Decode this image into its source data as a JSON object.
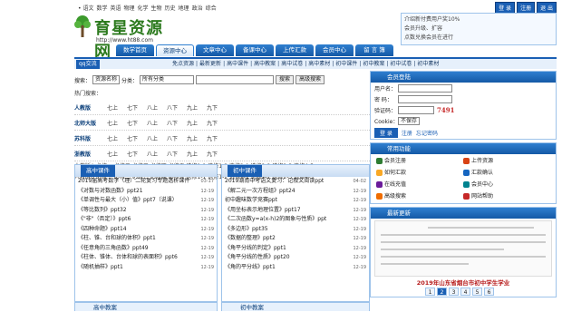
{
  "header": {
    "subjects": [
      "• 语文",
      "数学",
      "英语",
      "物理",
      "化学",
      "生物",
      "历史",
      "地理",
      "政治",
      "综合"
    ],
    "login_btn": "登 录",
    "register_btn": "注册",
    "logout_btn": "退 出",
    "logo_name": "育星资源网",
    "logo_url": "http://www.ht88.com",
    "notices": [
      "介绍新付费用户奖10%",
      "会员升级、扩容",
      "点数兑换会员在进行"
    ]
  },
  "nav": [
    "数学首页",
    "资源中心",
    "文章中心",
    "备课中心",
    "上传汇款",
    "会员中心",
    "留 言 簿"
  ],
  "nav_active": 1,
  "subnav": {
    "tag": "qq交流",
    "links": [
      "免点资源",
      "最新更新",
      "高中课件",
      "高中教案",
      "高中试卷",
      "高中素材",
      "初中课件",
      "初中教案",
      "初中试卷",
      "初中素材"
    ]
  },
  "search": {
    "label": "搜索：",
    "type_select": "资源名称",
    "cat_select": "所有分类",
    "search_btn": "搜索",
    "adv_btn": "高级搜索"
  },
  "hot_label": "热门搜索：",
  "editions": [
    {
      "name": "人教版",
      "grades": [
        "七上",
        "七下",
        "八上",
        "八下",
        "九上",
        "九下"
      ]
    },
    {
      "name": "北师大版",
      "grades": [
        "七上",
        "七下",
        "八上",
        "八下",
        "九上",
        "九下"
      ]
    },
    {
      "name": "苏科版",
      "grades": [
        "七上",
        "七下",
        "八上",
        "八下",
        "九上",
        "九下"
      ]
    },
    {
      "name": "浙教版",
      "grades": [
        "七上",
        "七下",
        "八上",
        "八下",
        "九上",
        "九下"
      ]
    }
  ],
  "high_a": "人教版A  必修一  必修二  必修三  必修四  必修五  选修1-1  选修1-2  选修2-1  选修2-2  选修2-3  选修4-5",
  "high_b": "人教版B  必修一  必修二  必修三  必修四  必修五  选修1-1  选修1-2  选修2-1  选修2-2  选修2-3  选修4-5",
  "panel_high": {
    "title": "高中课件",
    "items": [
      {
        "t": "2019届高考数学（理）二轮复习专题透析课件",
        "d": "03-17"
      },
      {
        "t": "《对数与对数函数》ppt21",
        "d": "12-19"
      },
      {
        "t": "《单调性与最大（小）值》ppt7（说课）",
        "d": "12-19"
      },
      {
        "t": "《等比数列》ppt32",
        "d": "12-19"
      },
      {
        "t": "《\"非\"（否定）》ppt6",
        "d": "12-19"
      },
      {
        "t": "《四种命题》ppt14",
        "d": "12-19"
      },
      {
        "t": "《柱、锥、台和球的体积》ppt1",
        "d": "12-19"
      },
      {
        "t": "《任意角的三角函数》ppt49",
        "d": "12-19"
      },
      {
        "t": "《柱体、锥体、台体和球的表面积》ppt6",
        "d": "12-19"
      },
      {
        "t": "《随机抽样》ppt1",
        "d": "12-19"
      }
    ]
  },
  "panel_mid": {
    "title": "初中课件",
    "items": [
      {
        "t": "2019湖南中考语文复习：记叙文阅读ppt",
        "d": "04-02"
      },
      {
        "t": "《解二元一次方程组》ppt24",
        "d": "12-19"
      },
      {
        "t": "初中趣味数学竞赛ppt",
        "d": "12-19"
      },
      {
        "t": "《用坐标表示地理位置》ppt17",
        "d": "12-19"
      },
      {
        "t": "《二次函数y=a(x-h)2的图象与性质》ppt",
        "d": "12-19"
      },
      {
        "t": "《多边形》ppt35",
        "d": "12-19"
      },
      {
        "t": "《数据的整理》ppt2",
        "d": "12-19"
      },
      {
        "t": "《角平分线的判定》ppt1",
        "d": "12-19"
      },
      {
        "t": "《角平分线的性质》ppt20",
        "d": "12-19"
      },
      {
        "t": "《角的平分线》ppt1",
        "d": "12-19"
      }
    ]
  },
  "bottom_tabs": [
    "高中教案",
    "初中教案"
  ],
  "side": {
    "login_title": "会员登陆",
    "user_label": "用户名：",
    "pass_label": "密  码：",
    "code_label": "验证码：",
    "code_value": "7491",
    "cookie_label": "Cookie：",
    "cookie_select": "不保存",
    "login_btn": "登 录",
    "register_link": "注册",
    "forgot_link": "忘记密码",
    "funcs_title": "常用功能",
    "funcs": [
      {
        "label": "会员注册",
        "icon": "user-add-icon",
        "color": "#2e7d32"
      },
      {
        "label": "上传资源",
        "icon": "upload-icon",
        "color": "#d84315"
      },
      {
        "label": "如何汇款",
        "icon": "money-icon",
        "color": "#f9a825"
      },
      {
        "label": "汇款确认",
        "icon": "confirm-icon",
        "color": "#1565c0"
      },
      {
        "label": "在线充值",
        "icon": "recharge-icon",
        "color": "#6a1b9a"
      },
      {
        "label": "会员中心",
        "icon": "member-icon",
        "color": "#00838f"
      },
      {
        "label": "高级搜索",
        "icon": "search-icon",
        "color": "#ef6c00"
      },
      {
        "label": "网站帮助",
        "icon": "help-icon",
        "color": "#c62828"
      }
    ],
    "latest_title": "最新更新",
    "latest_caption": "2019年山东省烟台市初中学生学业",
    "pager": [
      "1",
      "2",
      "3",
      "4",
      "5",
      "6"
    ],
    "pager_active": 1
  }
}
